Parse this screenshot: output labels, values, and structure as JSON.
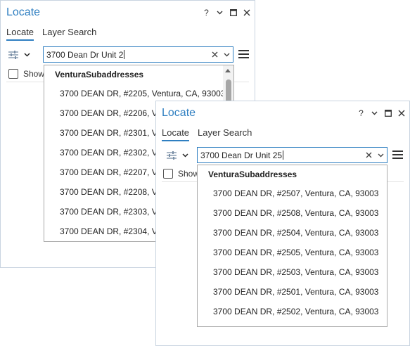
{
  "panes": [
    {
      "title": "Locate",
      "tabs": [
        "Locate",
        "Layer Search"
      ],
      "search_value": "3700 Dean Dr Unit 2",
      "show_label": "Show",
      "dropdown": {
        "header": "VenturaSubaddresses",
        "items": [
          "3700 DEAN DR, #2205, Ventura, CA, 93003",
          "3700 DEAN DR, #2206, Ventura, CA, 93003",
          "3700 DEAN DR, #2301, Ventura, CA, 93003",
          "3700 DEAN DR, #2302, Ventura, CA, 93003",
          "3700 DEAN DR, #2207, Ventura, CA, 93003",
          "3700 DEAN DR, #2208, Ventura, CA, 93003",
          "3700 DEAN DR, #2303, Ventura, CA, 93003",
          "3700 DEAN DR, #2304, Ventura, CA, 93003"
        ]
      }
    },
    {
      "title": "Locate",
      "tabs": [
        "Locate",
        "Layer Search"
      ],
      "search_value": "3700 Dean Dr Unit 25",
      "show_label": "Show",
      "dropdown": {
        "header": "VenturaSubaddresses",
        "items": [
          "3700 DEAN DR, #2507, Ventura, CA, 93003",
          "3700 DEAN DR, #2508, Ventura, CA, 93003",
          "3700 DEAN DR, #2504, Ventura, CA, 93003",
          "3700 DEAN DR, #2505, Ventura, CA, 93003",
          "3700 DEAN DR, #2503, Ventura, CA, 93003",
          "3700 DEAN DR, #2501, Ventura, CA, 93003",
          "3700 DEAN DR, #2502, Ventura, CA, 93003"
        ]
      }
    }
  ],
  "window_controls": {
    "help": "?"
  },
  "icons": {
    "help": "help-icon",
    "options": "chevron-down-icon",
    "restore": "maximize-icon",
    "close": "close-icon",
    "locator_settings": "sliders-icon",
    "clear": "clear-icon",
    "expand": "chevron-down-icon",
    "menu": "hamburger-menu-icon"
  },
  "colors": {
    "accent": "#2f7fc1",
    "title": "#2f7fc1",
    "border": "#c9d4e0"
  }
}
